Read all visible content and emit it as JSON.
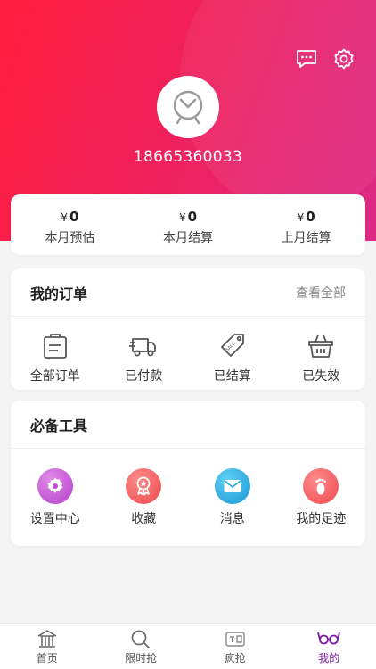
{
  "profile": {
    "phone": "18665360033"
  },
  "header_icons": {
    "message": "message-icon",
    "settings": "gear-icon"
  },
  "stats": [
    {
      "currency": "¥",
      "value": "0",
      "label": "本月预估"
    },
    {
      "currency": "¥",
      "value": "0",
      "label": "本月结算"
    },
    {
      "currency": "¥",
      "value": "0",
      "label": "上月结算"
    }
  ],
  "orders": {
    "title": "我的订单",
    "view_all": "查看全部",
    "items": [
      {
        "label": "全部订单",
        "icon": "clipboard-icon"
      },
      {
        "label": "已付款",
        "icon": "delivery-truck-icon"
      },
      {
        "label": "已结算",
        "icon": "sale-tag-icon"
      },
      {
        "label": "已失效",
        "icon": "basket-icon"
      }
    ]
  },
  "tools": {
    "title": "必备工具",
    "items": [
      {
        "label": "设置中心",
        "icon": "settings-gear-icon",
        "color": "#c64bd8"
      },
      {
        "label": "收藏",
        "icon": "favorite-ribbon-icon",
        "color": "#f15b5b"
      },
      {
        "label": "消息",
        "icon": "envelope-icon",
        "color": "#1fa6dc"
      },
      {
        "label": "我的足迹",
        "icon": "footprint-icon",
        "color": "#f2565e"
      }
    ]
  },
  "tabbar": {
    "active": "我的",
    "items": [
      {
        "label": "首页",
        "icon": "home-icon"
      },
      {
        "label": "限时抢",
        "icon": "search-icon"
      },
      {
        "label": "疯抢",
        "icon": "flash-sale-icon"
      },
      {
        "label": "我的",
        "icon": "profile-icon"
      }
    ]
  },
  "colors": {
    "header_start": "#ff1e3d",
    "header_end": "#dc2a86",
    "active_tab": "#7b1fa2"
  }
}
